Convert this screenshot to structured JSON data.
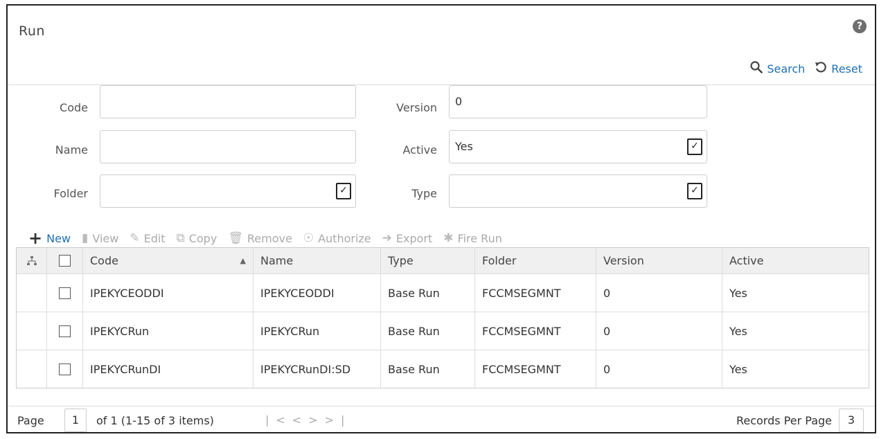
{
  "header": {
    "title": "Run",
    "help_icon": "?"
  },
  "actions": {
    "search_label": "Search",
    "reset_label": "Reset"
  },
  "form": {
    "code": {
      "label": "Code",
      "value": ""
    },
    "name": {
      "label": "Name",
      "value": ""
    },
    "folder": {
      "label": "Folder",
      "value": ""
    },
    "version": {
      "label": "Version",
      "value": "0"
    },
    "active": {
      "label": "Active",
      "value": "Yes"
    },
    "type": {
      "label": "Type",
      "value": ""
    }
  },
  "toolbar": {
    "new": "New",
    "view": "View",
    "edit": "Edit",
    "copy": "Copy",
    "remove": "Remove",
    "authorize": "Authorize",
    "export": "Export",
    "fire_run": "Fire Run"
  },
  "table": {
    "columns": [
      "Code",
      "Name",
      "Type",
      "Folder",
      "Version",
      "Active"
    ],
    "rows": [
      {
        "code": "IPEKYCEODDI",
        "name": "IPEKYCEODDI",
        "type": "Base Run",
        "folder": "FCCMSEGMNT",
        "version": "0",
        "active": "Yes"
      },
      {
        "code": "IPEKYCRun",
        "name": "IPEKYCRun",
        "type": "Base Run",
        "folder": "FCCMSEGMNT",
        "version": "0",
        "active": "Yes"
      },
      {
        "code": "IPEKYCRunDI",
        "name": "IPEKYCRunDI:SD",
        "type": "Base Run",
        "folder": "FCCMSEGMNT",
        "version": "0",
        "active": "Yes"
      }
    ]
  },
  "pager": {
    "page_label": "Page",
    "page": "1",
    "of_text": "of 1 (1-15 of 3 items)",
    "records_label": "Records Per Page",
    "records": "3"
  },
  "colors": {
    "link": "#1f6fb2",
    "border": "#cccccc",
    "header_bg": "#f0f0f0"
  }
}
